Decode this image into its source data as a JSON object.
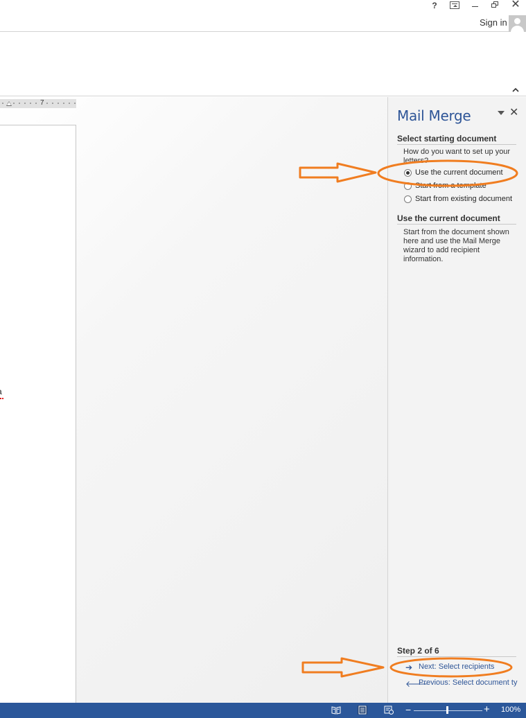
{
  "titlebar": {
    "help_label": "?",
    "close_label": "✕",
    "signin_label": "Sign in"
  },
  "ruler": {
    "tick_label": "7"
  },
  "document": {
    "visible_text": "a"
  },
  "pane": {
    "title": "Mail Merge",
    "close_label": "✕",
    "section1_title": "Select starting document",
    "question": "How do you want to set up your letters?",
    "options": [
      {
        "label": "Use the current document",
        "selected": true
      },
      {
        "label": "Start from a template",
        "selected": false
      },
      {
        "label": "Start from existing document",
        "selected": false
      }
    ],
    "section2_title": "Use the current document",
    "description": "Start from the document shown here and use the Mail Merge wizard to add recipient information.",
    "step_label": "Step 2 of 6",
    "next_label": "Next: Select recipients",
    "prev_label": "Previous: Select document ty"
  },
  "statusbar": {
    "zoom_label": "100%",
    "zoom_percent": 100,
    "minus_label": "−",
    "plus_label": "+"
  },
  "colors": {
    "accent": "#2e5597",
    "statusbar": "#2b579a",
    "annotation": "#f07d20"
  },
  "icons": [
    "help-icon",
    "ribbon-display-options-icon",
    "minimize-icon",
    "restore-icon",
    "close-icon",
    "avatar-icon",
    "collapse-ribbon-icon",
    "pane-options-icon",
    "arrow-right-icon",
    "arrow-left-icon",
    "read-mode-icon",
    "print-layout-icon",
    "web-layout-icon"
  ]
}
